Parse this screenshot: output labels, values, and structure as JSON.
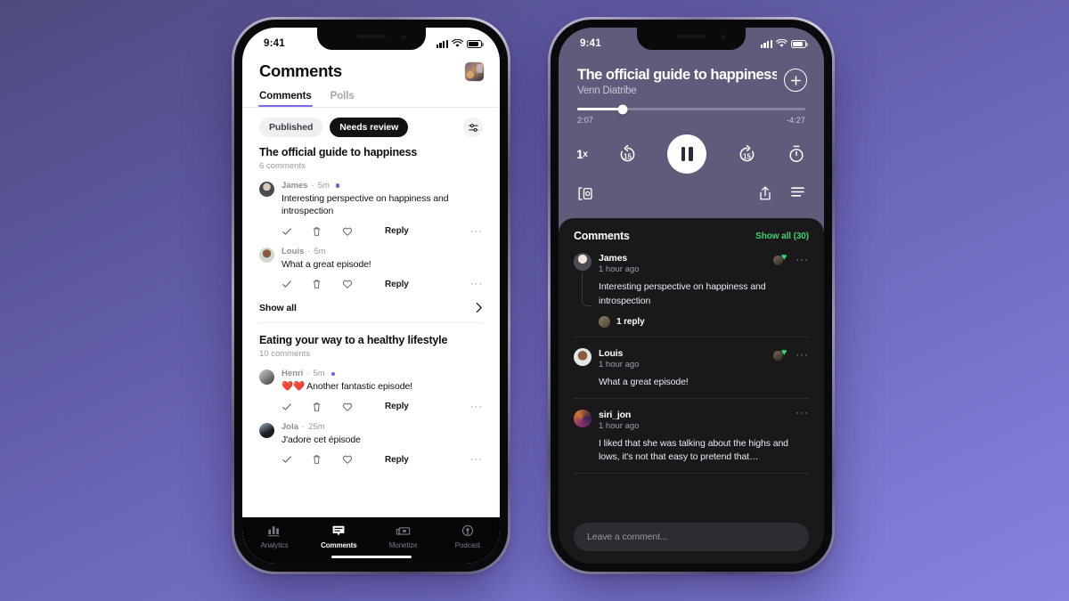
{
  "background": {
    "gradient_from": "#4e4a7e",
    "gradient_to": "#8782e0"
  },
  "accent": {
    "purple": "#7b68ee",
    "green": "#3ecf6e",
    "new_dot": "#6f5cf0"
  },
  "left_phone": {
    "status": {
      "time": "9:41",
      "signal_icon": "cellular-bars-icon",
      "wifi_icon": "wifi-icon",
      "battery_icon": "battery-icon"
    },
    "header": {
      "title": "Comments",
      "artwork_icon": "album-artwork-thumbnail"
    },
    "tabs": [
      {
        "label": "Comments",
        "active": true
      },
      {
        "label": "Polls",
        "active": false
      }
    ],
    "chips": [
      {
        "label": "Published",
        "selected": false
      },
      {
        "label": "Needs review",
        "selected": true
      }
    ],
    "filter_icon": "sliders-filter-icon",
    "sections": [
      {
        "title": "The official guide to happiness",
        "count": "6 comments",
        "comments": [
          {
            "author": "James",
            "time": "5m",
            "unread": true,
            "text": "Interesting perspective on happiness and introspection",
            "actions": {
              "approve": "check-icon",
              "delete": "trash-icon",
              "like": "heart-icon",
              "reply": "Reply",
              "more": "···"
            }
          },
          {
            "author": "Louis",
            "time": "5m",
            "unread": false,
            "text": "What a great episode!",
            "actions": {
              "approve": "check-icon",
              "delete": "trash-icon",
              "like": "heart-icon",
              "reply": "Reply",
              "more": "···"
            }
          }
        ],
        "show_all": "Show all"
      },
      {
        "title": "Eating your way to a healthy lifestyle",
        "count": "10 comments",
        "comments": [
          {
            "author": "Henri",
            "time": "5m",
            "unread": true,
            "text": "❤️❤️ Another fantastic episode!",
            "actions": {
              "approve": "check-icon",
              "delete": "trash-icon",
              "like": "heart-icon",
              "reply": "Reply",
              "more": "···"
            }
          },
          {
            "author": "Jola",
            "time": "25m",
            "unread": false,
            "text": "J'adore cet épisode",
            "actions": {
              "approve": "check-icon",
              "delete": "trash-icon",
              "like": "heart-icon",
              "reply": "Reply",
              "more": "···"
            }
          }
        ]
      }
    ],
    "tabbar": [
      {
        "label": "Analytics",
        "icon": "bar-chart-icon",
        "active": false
      },
      {
        "label": "Comments",
        "icon": "comment-bubble-icon",
        "active": true
      },
      {
        "label": "Monetize",
        "icon": "money-icon",
        "active": false
      },
      {
        "label": "Podcast",
        "icon": "microphone-icon",
        "active": false
      }
    ]
  },
  "right_phone": {
    "status": {
      "time": "9:41",
      "signal_icon": "cellular-bars-icon",
      "wifi_icon": "wifi-icon",
      "battery_icon": "battery-icon"
    },
    "player": {
      "title": "The official guide to happiness",
      "author": "Venn Diatribe",
      "add_icon": "plus-circle-icon",
      "elapsed": "2:07",
      "remaining": "-4:27",
      "progress_percent": 20,
      "controls": {
        "speed": "1",
        "speed_suffix": "x",
        "rewind": "15",
        "rewind_icon": "rewind-15-icon",
        "play_state": "pause-icon",
        "forward": "15",
        "forward_icon": "forward-15-icon",
        "sleep_timer_icon": "sleep-timer-icon"
      },
      "secondary_icons": {
        "cast": "airplay-cast-icon",
        "share": "share-icon",
        "queue": "queue-list-icon"
      }
    },
    "comments_panel": {
      "title": "Comments",
      "show_all": "Show all (30)",
      "comments": [
        {
          "author": "James",
          "time": "1 hour ago",
          "text": "Interesting perspective on happiness and introspection",
          "reaction_icon": "green-heart-reaction",
          "more_icon": "···",
          "reply_count": "1 reply"
        },
        {
          "author": "Louis",
          "time": "1 hour ago",
          "text": "What a great episode!",
          "reaction_icon": "green-heart-reaction",
          "more_icon": "···"
        },
        {
          "author": "siri_jon",
          "time": "1 hour ago",
          "text": "I liked that she was talking about the highs and lows, it's not that easy to pretend that…",
          "more_icon": "···"
        }
      ],
      "composer_placeholder": "Leave a comment..."
    }
  }
}
